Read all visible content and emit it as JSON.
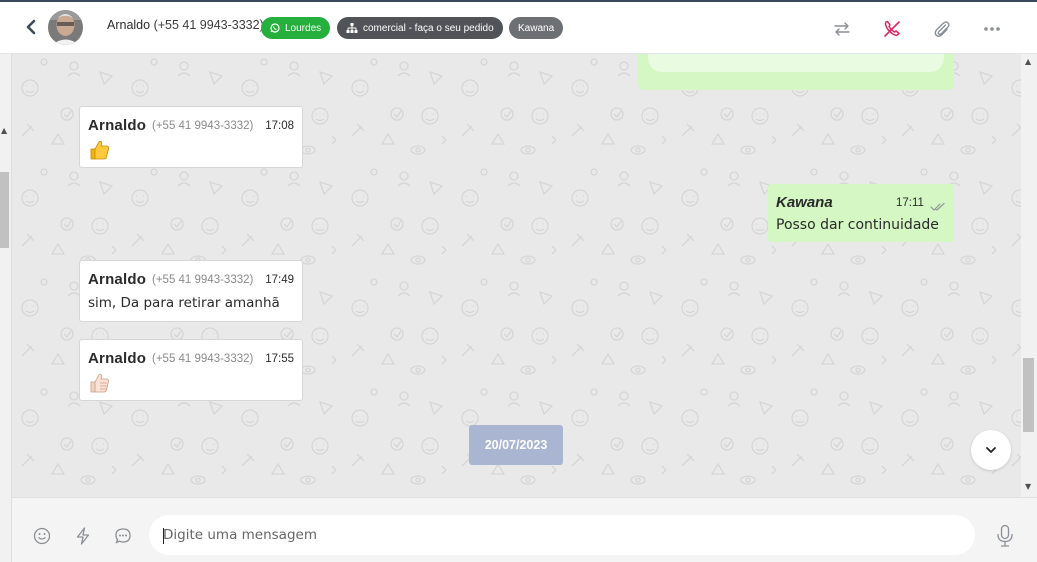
{
  "header": {
    "contact_name": "Arnaldo",
    "contact_phone": "(+55 41 9943-3332)",
    "tags": [
      {
        "label": "Lourdes",
        "color": "#25b03d",
        "icon": "whatsapp-icon"
      },
      {
        "label": "comercial - faça o seu pedido",
        "color": "#505357",
        "icon": "sitemap-icon"
      },
      {
        "label": "Kawana",
        "color": "#6c7075"
      }
    ],
    "actions": [
      "transfer-icon",
      "end-call-icon",
      "attachment-icon",
      "more-icon"
    ]
  },
  "messages": [
    {
      "direction": "in",
      "sender": "Arnaldo",
      "phone": "(+55 41 9943-3332)",
      "time": "17:08",
      "content": "thumbs-up-emoji"
    },
    {
      "direction": "out",
      "sender": "Kawana",
      "time": "17:11",
      "text": "Posso dar continuidade",
      "status": "double-check-icon"
    },
    {
      "direction": "in",
      "sender": "Arnaldo",
      "phone": "(+55 41 9943-3332)",
      "time": "17:49",
      "text": "sim, Da para retirar amanhã"
    },
    {
      "direction": "in",
      "sender": "Arnaldo",
      "phone": "(+55 41 9943-3332)",
      "time": "17:55",
      "content": "thumbs-up-light-emoji"
    }
  ],
  "date_separator": "20/07/2023",
  "composer": {
    "placeholder": "Digite uma mensagem",
    "icons": [
      "emoji-icon",
      "lightning-icon",
      "chat-bubble-icon",
      "microphone-icon"
    ]
  },
  "colors": {
    "outgoing_bubble": "#d4f7c4",
    "date_pill": "#a9b5d1",
    "end_call": "#e0245e"
  }
}
